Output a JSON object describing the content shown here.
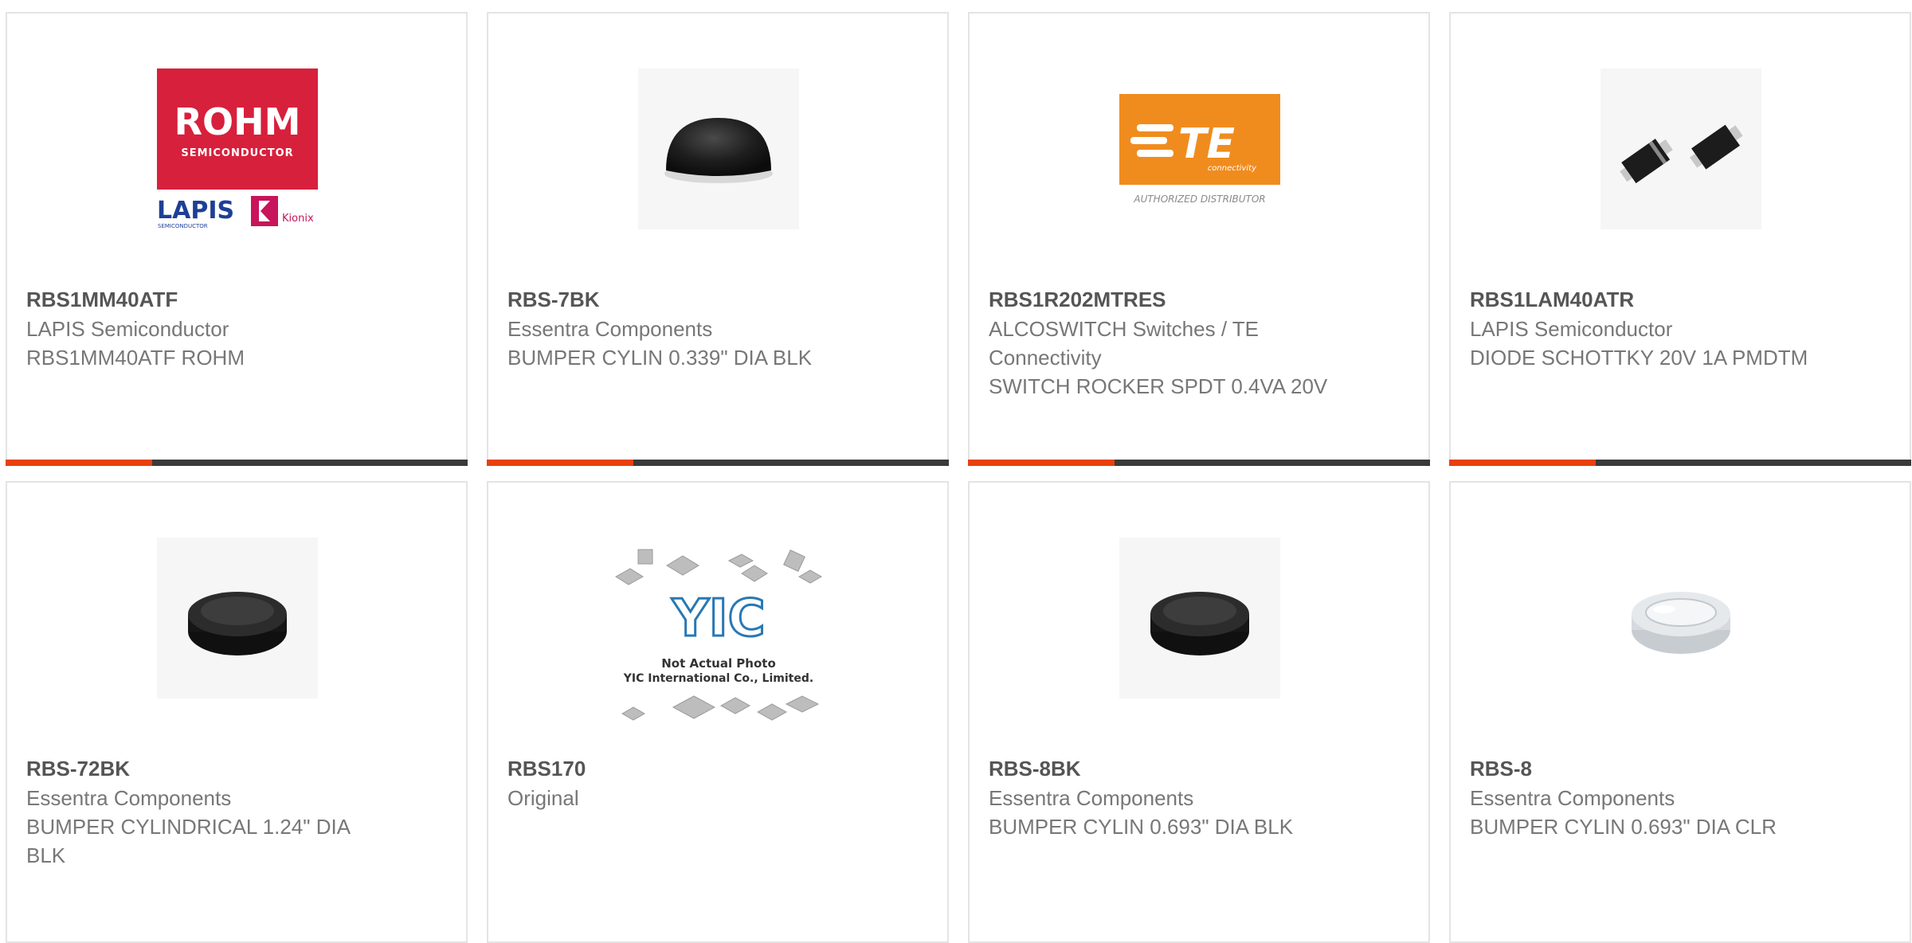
{
  "colors": {
    "accent": "#e8400c",
    "bar_dark": "#3a3a3a",
    "rohm_red": "#d7203c",
    "te_orange": "#f08c1e",
    "lapis_blue": "#1e3f96"
  },
  "products": [
    {
      "part_number": "RBS1MM40ATF",
      "manufacturer": "LAPIS Semiconductor",
      "description": "RBS1MM40ATF ROHM",
      "image": "rohm-lapis-kionix-logo",
      "logo_text": {
        "rohm": "ROHM",
        "rohm_sub": "SEMICONDUCTOR",
        "lapis": "LAPIS",
        "lapis_sub": "SEMICONDUCTOR",
        "kionix": "Kionix"
      }
    },
    {
      "part_number": "RBS-7BK",
      "manufacturer": "Essentra Components",
      "description": "BUMPER CYLIN 0.339\" DIA BLK",
      "image": "black-dome-bumper"
    },
    {
      "part_number": "RBS1R202MTRES",
      "manufacturer": "ALCOSWITCH Switches / TE Connectivity",
      "description": "SWITCH ROCKER SPDT 0.4VA 20V",
      "image": "te-connectivity-logo",
      "logo_text": {
        "te": "TE",
        "te_sub": "connectivity",
        "caption": "AUTHORIZED DISTRIBUTOR"
      }
    },
    {
      "part_number": "RBS1LAM40ATR",
      "manufacturer": "LAPIS Semiconductor",
      "description": "DIODE SCHOTTKY 20V 1A PMDTM",
      "image": "smd-diode-packages"
    },
    {
      "part_number": "RBS-72BK",
      "manufacturer": "Essentra Components",
      "description": "BUMPER CYLINDRICAL 1.24\" DIA BLK",
      "image": "black-cylinder-bumper"
    },
    {
      "part_number": "RBS170",
      "manufacturer": "Original",
      "description": "",
      "image": "yic-placeholder",
      "logo_text": {
        "yic": "YIC",
        "line1": "Not Actual Photo",
        "line2": "YIC International Co., Limited."
      }
    },
    {
      "part_number": "RBS-8BK",
      "manufacturer": "Essentra Components",
      "description": "BUMPER CYLIN 0.693\" DIA BLK",
      "image": "black-cylinder-bumper"
    },
    {
      "part_number": "RBS-8",
      "manufacturer": "Essentra Components",
      "description": "BUMPER CYLIN 0.693\" DIA CLR",
      "image": "clear-cylinder-bumper"
    }
  ]
}
